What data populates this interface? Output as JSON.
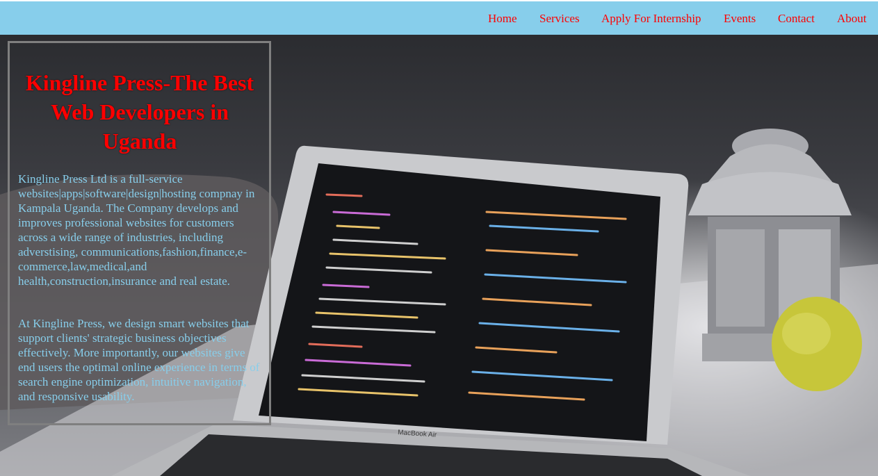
{
  "nav": {
    "items": [
      {
        "label": "Home"
      },
      {
        "label": "Services"
      },
      {
        "label": "Apply For Internship"
      },
      {
        "label": "Events"
      },
      {
        "label": "Contact"
      },
      {
        "label": "About"
      }
    ]
  },
  "hero": {
    "title": "Kingline Press-The Best Web Developers in Uganda",
    "paragraphs": [
      "Kingline Press Ltd is a full-service websites|apps|software|design|hosting compnay in Kampala Uganda. The Company develops and improves professional websites for customers across a wide range of industries, including adverstising, communications,fashion,finance,e-commerce,law,medical,and health,construction,insurance and real estate.",
      "At Kingline Press, we design smart websites that support clients' strategic business objectives effectively. More importantly, our websites give end users the optimal online experience in terms of search engine optimization, intuitive navigation, and responsive usability."
    ],
    "laptop_brand": "MacBook Air"
  },
  "colors": {
    "nav_bg": "#87ceeb",
    "nav_link": "#ff0000",
    "title": "#ff0000",
    "paragraph": "#87ceeb",
    "box_border": "#7f7f7f"
  }
}
